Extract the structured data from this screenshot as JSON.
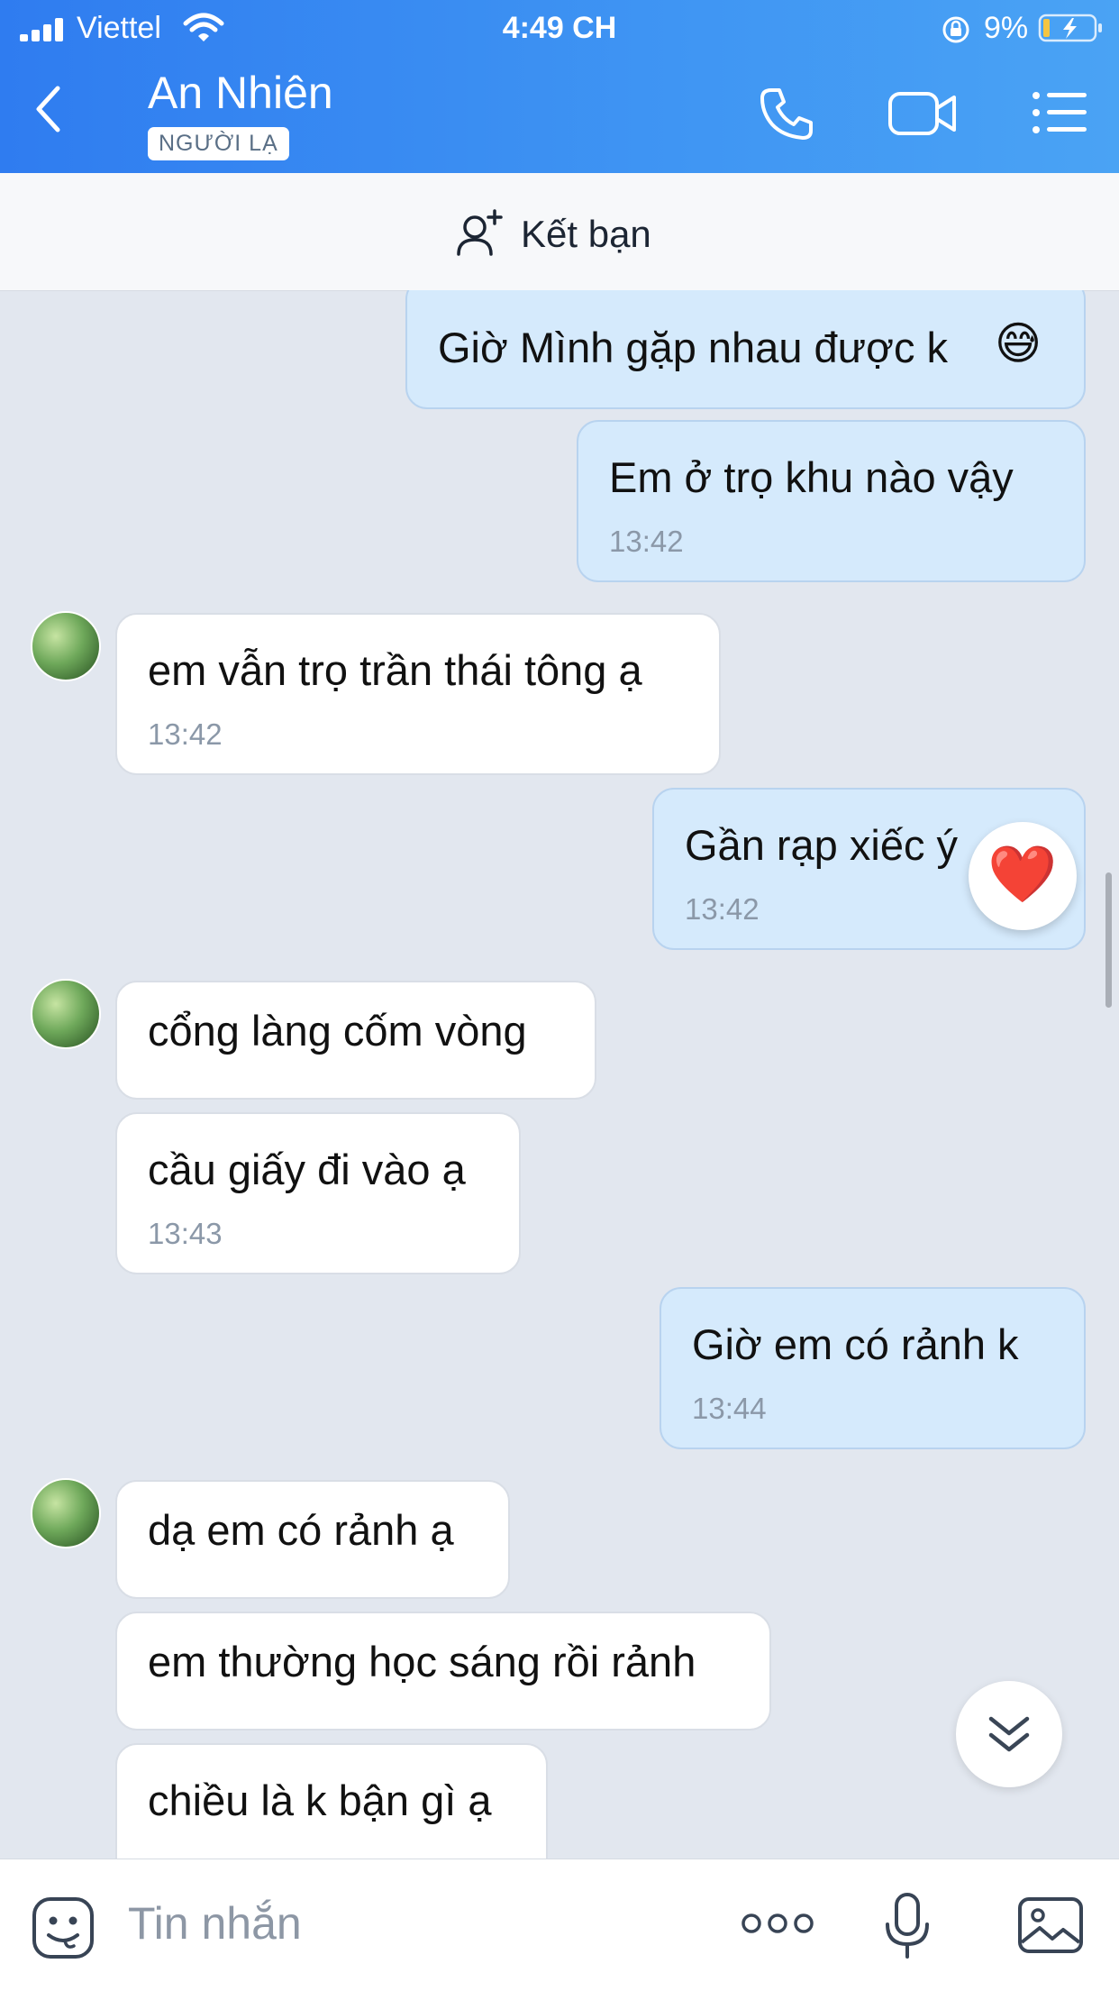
{
  "status_bar": {
    "carrier": "Viettel",
    "time": "4:49 CH",
    "battery_percent": "9%"
  },
  "header": {
    "contact_name": "An Nhiên",
    "badge": "NGƯỜI LẠ",
    "accent_color": "#3a8ff2"
  },
  "add_friend": {
    "label": "Kết bạn"
  },
  "messages": [
    {
      "from": "me",
      "text": "Giờ Mình gặp nhau được k",
      "emoji": "😅"
    },
    {
      "from": "me",
      "text": "Em ở trọ khu nào vậy",
      "time": "13:42"
    },
    {
      "from": "them",
      "text": "em vẫn trọ trần thái tông ạ",
      "time": "13:42"
    },
    {
      "from": "me",
      "text": "Gần rạp xiếc ý",
      "time": "13:42",
      "reaction": "❤️"
    },
    {
      "from": "them",
      "text": "cổng làng cốm vòng"
    },
    {
      "from": "them",
      "text": "cầu giấy đi vào ạ",
      "time": "13:43"
    },
    {
      "from": "me",
      "text": "Giờ em có rảnh k",
      "time": "13:44"
    },
    {
      "from": "them",
      "text": "dạ em có rảnh ạ"
    },
    {
      "from": "them",
      "text": "em thường học sáng rồi rảnh"
    },
    {
      "from": "them",
      "text": "chiều là k bận gì ạ"
    }
  ],
  "composer": {
    "placeholder": "Tin nhắn"
  }
}
